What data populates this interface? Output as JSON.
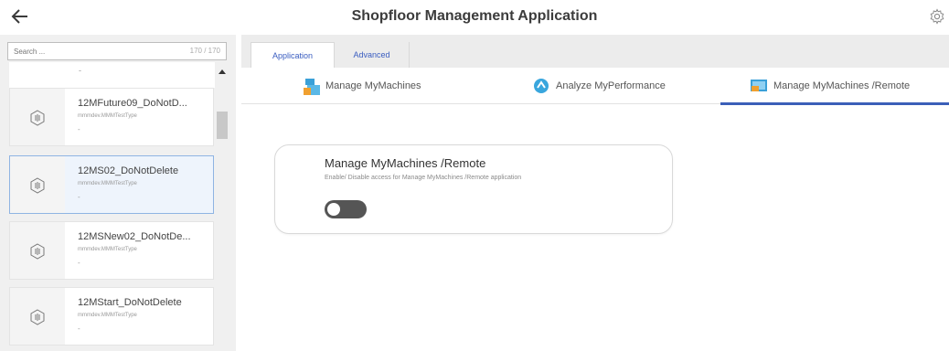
{
  "header": {
    "title": "Shopfloor Management Application"
  },
  "search": {
    "placeholder": "Search ...",
    "count": "170 / 170"
  },
  "sidebar": {
    "partial_item": {
      "sub": "-"
    },
    "items": [
      {
        "name": "12MFuture09_DoNotD...",
        "type": "mmmdev.MMMTestType",
        "sub": "-"
      },
      {
        "name": "12MS02_DoNotDelete",
        "type": "mmmdev.MMMTestType",
        "sub": "-"
      },
      {
        "name": "12MSNew02_DoNotDe...",
        "type": "mmmdev.MMMTestType",
        "sub": "-"
      },
      {
        "name": "12MStart_DoNotDelete",
        "type": "mmmdev.MMMTestType",
        "sub": "-"
      }
    ]
  },
  "tabs": {
    "application": "Application",
    "advanced": "Advanced"
  },
  "subtabs": {
    "manage": "Manage MyMachines",
    "analyze": "Analyze MyPerformance",
    "remote": "Manage MyMachines /Remote"
  },
  "panel": {
    "title": "Manage MyMachines /Remote",
    "description": "Enable/ Disable access for Manage MyMachines /Remote application",
    "toggle_on": false
  },
  "colors": {
    "accent": "#3b5fb8",
    "selected_border": "#8fb4e3",
    "toggle_off": "#555555"
  }
}
